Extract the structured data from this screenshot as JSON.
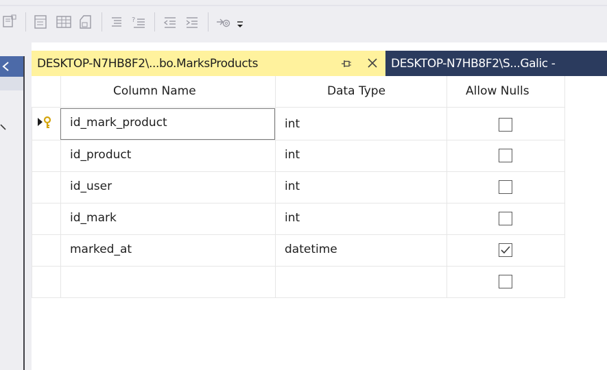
{
  "toolbar": {
    "buttons": [
      {
        "icon": "generate-change-script-icon"
      },
      {
        "icon": "set-primary-key-icon"
      },
      {
        "icon": "relationships-icon"
      },
      {
        "icon": "manage-indexes-icon"
      },
      {
        "icon": "manage-fulltext-icon"
      },
      {
        "icon": "manage-xml-indexes-icon"
      },
      {
        "icon": "decrease-indent-icon"
      },
      {
        "icon": "increase-indent-icon"
      },
      {
        "icon": "add-constraint-icon"
      }
    ],
    "overflow_icon": "toolbar-overflow-icon"
  },
  "tabs": [
    {
      "label": "DESKTOP-N7HB8F2\\...bo.MarksProducts",
      "active": true
    },
    {
      "label": "DESKTOP-N7HB8F2\\S...Galic -",
      "active": false
    }
  ],
  "grid": {
    "headers": {
      "column_name": "Column Name",
      "data_type": "Data Type",
      "allow_nulls": "Allow Nulls"
    },
    "rows": [
      {
        "name": "id_mark_product",
        "type": "int",
        "allow_nulls": false,
        "primary_key": true
      },
      {
        "name": "id_product",
        "type": "int",
        "allow_nulls": false
      },
      {
        "name": "id_user",
        "type": "int",
        "allow_nulls": false
      },
      {
        "name": "id_mark",
        "type": "int",
        "allow_nulls": false
      },
      {
        "name": "marked_at",
        "type": "datetime",
        "allow_nulls": true
      },
      {
        "name": "",
        "type": "",
        "allow_nulls": false
      }
    ]
  },
  "colors": {
    "active_tab": "#fff29d",
    "tab_strip": "#2b3b5e",
    "toolbar_bg": "#eeeef2",
    "key_icon": "#d4a40c"
  }
}
